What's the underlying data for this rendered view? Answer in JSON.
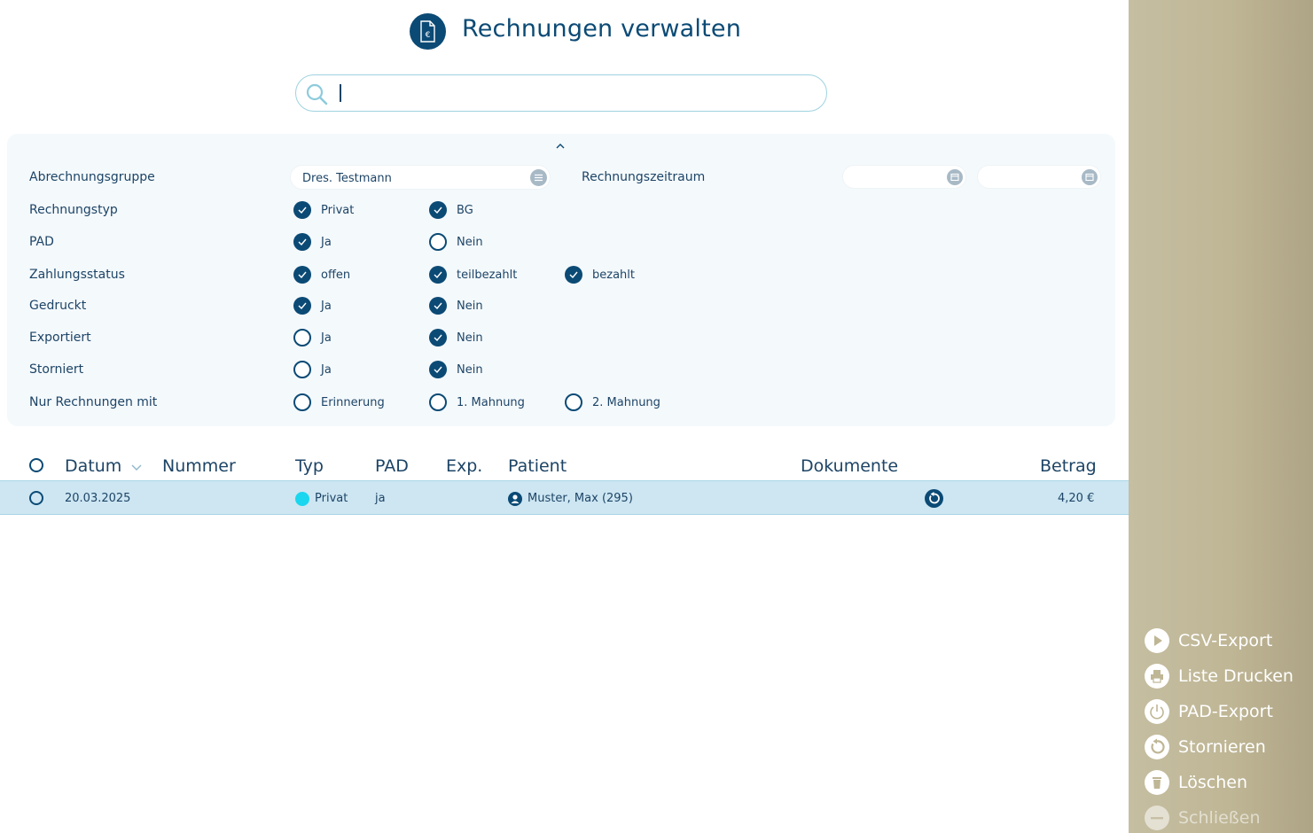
{
  "header": {
    "title": "Rechnungen verwalten",
    "icon": "invoice-euro-icon"
  },
  "search": {
    "placeholder": "",
    "value": ""
  },
  "filters": {
    "abrechnungsgruppe": {
      "label": "Abrechnungsgruppe",
      "value": "Dres. Testmann"
    },
    "rechnungszeitraum": {
      "label": "Rechnungszeitraum",
      "from": "",
      "to": ""
    },
    "rows": [
      {
        "label": "Rechnungstyp",
        "options": [
          {
            "label": "Privat",
            "checked": true
          },
          {
            "label": "BG",
            "checked": true
          }
        ]
      },
      {
        "label": "PAD",
        "options": [
          {
            "label": "Ja",
            "checked": true
          },
          {
            "label": "Nein",
            "checked": false
          }
        ]
      },
      {
        "label": "Zahlungsstatus",
        "options": [
          {
            "label": "offen",
            "checked": true
          },
          {
            "label": "teilbezahlt",
            "checked": true
          },
          {
            "label": "bezahlt",
            "checked": true
          }
        ]
      },
      {
        "label": "Gedruckt",
        "options": [
          {
            "label": "Ja",
            "checked": true
          },
          {
            "label": "Nein",
            "checked": true
          }
        ]
      },
      {
        "label": "Exportiert",
        "options": [
          {
            "label": "Ja",
            "checked": false
          },
          {
            "label": "Nein",
            "checked": true
          }
        ]
      },
      {
        "label": "Storniert",
        "options": [
          {
            "label": "Ja",
            "checked": false
          },
          {
            "label": "Nein",
            "checked": true
          }
        ]
      },
      {
        "label": "Nur Rechnungen mit",
        "options": [
          {
            "label": "Erinnerung",
            "checked": false
          },
          {
            "label": "1. Mahnung",
            "checked": false
          },
          {
            "label": "2. Mahnung",
            "checked": false
          }
        ]
      }
    ]
  },
  "table": {
    "columns": {
      "datum": "Datum",
      "nummer": "Nummer",
      "typ": "Typ",
      "pad": "PAD",
      "exp": "Exp.",
      "patient": "Patient",
      "dokumente": "Dokumente",
      "betrag": "Betrag"
    },
    "sort": "datum-desc",
    "rows": [
      {
        "datum": "20.03.2025",
        "nummer": "",
        "typ": "Privat",
        "typ_color": "#1ad6ef",
        "pad": "ja",
        "exp": "",
        "patient": "Muster, Max (295)",
        "betrag": "4,20 €"
      }
    ]
  },
  "actions": [
    {
      "label": "CSV-Export",
      "icon": "play-icon",
      "enabled": true
    },
    {
      "label": "Liste Drucken",
      "icon": "printer-icon",
      "enabled": true
    },
    {
      "label": "PAD-Export",
      "icon": "export-icon",
      "enabled": true
    },
    {
      "label": "Stornieren",
      "icon": "undo-icon",
      "enabled": true
    },
    {
      "label": "Löschen",
      "icon": "trash-icon",
      "enabled": true
    },
    {
      "label": "Schließen",
      "icon": "minus-icon",
      "enabled": false
    }
  ],
  "colors": {
    "primary": "#0b4a75",
    "rowHighlight": "#cde6f2",
    "sidebar": "#bfb695",
    "typePrivat": "#1ad6ef"
  }
}
